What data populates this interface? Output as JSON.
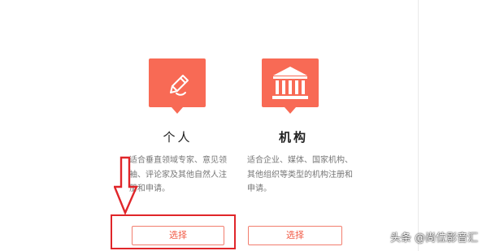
{
  "cards": [
    {
      "icon": "pen-icon",
      "title": "个人",
      "description": "适合垂直领域专家、意见领袖、评论家及其他自然人注册和申请。",
      "button_label": "选择"
    },
    {
      "icon": "institution-building-icon",
      "title": "机构",
      "description": "适合企业、媒体、国家机构、其他组织等类型的机构注册和申请。",
      "button_label": "选择"
    }
  ],
  "watermark": "头条 @尚位影音汇",
  "colors": {
    "accent": "#f86a55",
    "button_border": "#f27d6e",
    "annotation_red": "#e0262a"
  }
}
